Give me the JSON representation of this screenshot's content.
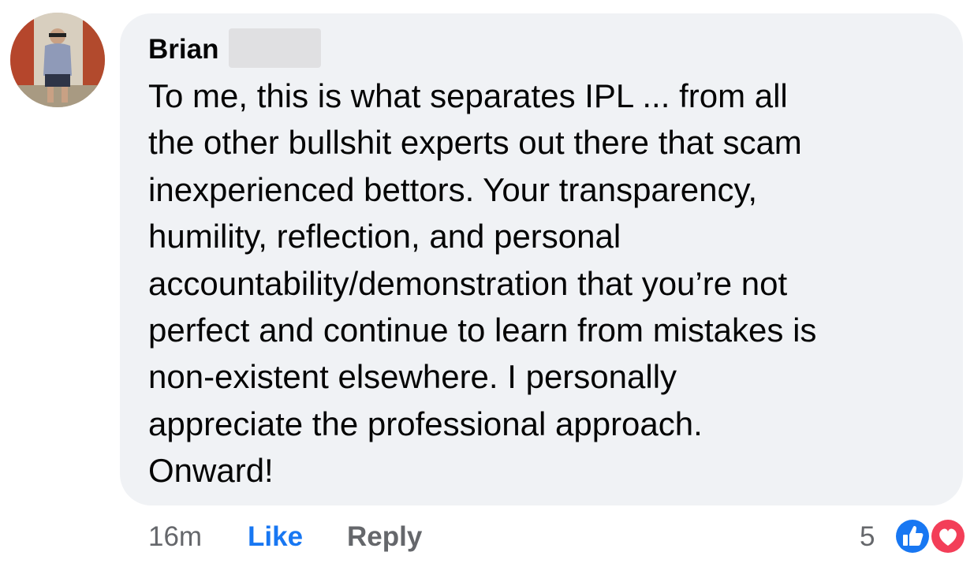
{
  "comment": {
    "author": "Brian",
    "lines": [
      "To me, this is what separates IPL ... from all",
      "the other bullshit experts out there that scam",
      "inexperienced bettors. Your transparency,",
      "humility, reflection, and personal",
      "accountability/demonstration that you’re not",
      "perfect and continue to learn from mistakes is",
      "non-existent elsewhere. I personally",
      "appreciate the professional approach.",
      "Onward!"
    ],
    "time": "16m",
    "like_label": "Like",
    "reply_label": "Reply",
    "reaction_count": "5",
    "reactions": [
      "thumbs-up-icon",
      "heart-icon"
    ]
  },
  "colors": {
    "bubble": "#f0f2f5",
    "like_blue": "#1877f2",
    "meta_gray": "#65676b",
    "love_red": "#f33e58"
  }
}
